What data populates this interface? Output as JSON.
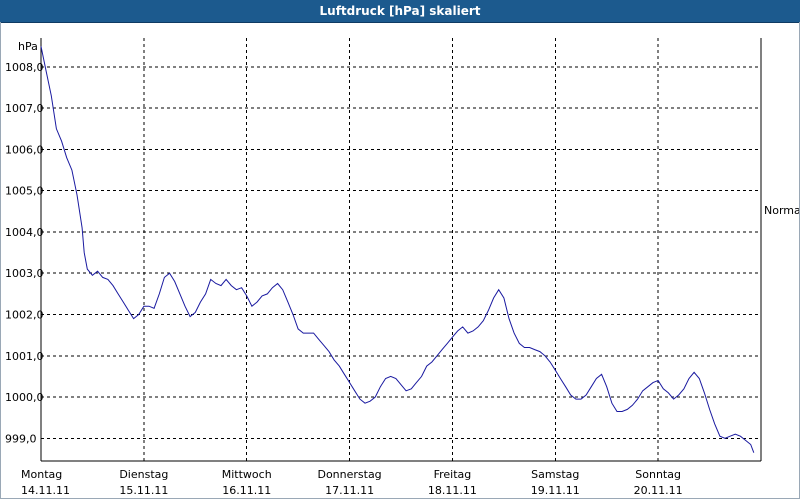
{
  "window": {
    "title": "Luftdruck [hPa] skaliert"
  },
  "chart_data": {
    "type": "line",
    "title": "Luftdruck [hPa] skaliert",
    "ylabel": "hPa",
    "ylim": [
      998.45,
      1008.7
    ],
    "yticks": [
      999.0,
      1000.0,
      1001.0,
      1002.0,
      1003.0,
      1004.0,
      1005.0,
      1006.0,
      1007.0,
      1008.0
    ],
    "ytick_labels": [
      "999,0",
      "1000,0",
      "1001,0",
      "1002,0",
      "1003,0",
      "1004,0",
      "1005,0",
      "1006,0",
      "1007,0",
      "1008,0"
    ],
    "xlim": [
      0,
      7
    ],
    "xticks": [
      {
        "x": 0,
        "day": "Montag",
        "date": "14.11.11"
      },
      {
        "x": 1,
        "day": "Dienstag",
        "date": "15.11.11"
      },
      {
        "x": 2,
        "day": "Mittwoch",
        "date": "16.11.11"
      },
      {
        "x": 3,
        "day": "Donnerstag",
        "date": "17.11.11"
      },
      {
        "x": 4,
        "day": "Freitag",
        "date": "18.11.11"
      },
      {
        "x": 5,
        "day": "Samstag",
        "date": "19.11.11"
      },
      {
        "x": 6,
        "day": "Sonntag",
        "date": "20.11.11"
      }
    ],
    "reference_label": "Normal",
    "grid": true,
    "grid_style": "dashed",
    "colors": {
      "line": "#1a1aa0",
      "grid": "#000000",
      "title_bar": "#1c5a8e"
    },
    "series": [
      {
        "values": [
          [
            0.0,
            1008.5
          ],
          [
            0.05,
            1007.9
          ],
          [
            0.1,
            1007.3
          ],
          [
            0.15,
            1006.5
          ],
          [
            0.2,
            1006.2
          ],
          [
            0.25,
            1005.8
          ],
          [
            0.3,
            1005.5
          ],
          [
            0.35,
            1004.9
          ],
          [
            0.4,
            1004.1
          ],
          [
            0.42,
            1003.5
          ],
          [
            0.45,
            1003.1
          ],
          [
            0.5,
            1002.95
          ],
          [
            0.55,
            1003.05
          ],
          [
            0.6,
            1002.9
          ],
          [
            0.65,
            1002.85
          ],
          [
            0.7,
            1002.7
          ],
          [
            0.75,
            1002.5
          ],
          [
            0.8,
            1002.3
          ],
          [
            0.85,
            1002.1
          ],
          [
            0.9,
            1001.9
          ],
          [
            0.95,
            1002.0
          ],
          [
            1.0,
            1002.2
          ],
          [
            1.05,
            1002.2
          ],
          [
            1.1,
            1002.15
          ],
          [
            1.15,
            1002.5
          ],
          [
            1.2,
            1002.9
          ],
          [
            1.25,
            1003.0
          ],
          [
            1.3,
            1002.8
          ],
          [
            1.35,
            1002.5
          ],
          [
            1.4,
            1002.2
          ],
          [
            1.45,
            1001.95
          ],
          [
            1.5,
            1002.05
          ],
          [
            1.55,
            1002.3
          ],
          [
            1.6,
            1002.5
          ],
          [
            1.65,
            1002.85
          ],
          [
            1.7,
            1002.75
          ],
          [
            1.75,
            1002.7
          ],
          [
            1.8,
            1002.85
          ],
          [
            1.85,
            1002.7
          ],
          [
            1.9,
            1002.6
          ],
          [
            1.95,
            1002.65
          ],
          [
            2.0,
            1002.45
          ],
          [
            2.05,
            1002.2
          ],
          [
            2.1,
            1002.3
          ],
          [
            2.15,
            1002.45
          ],
          [
            2.2,
            1002.5
          ],
          [
            2.25,
            1002.65
          ],
          [
            2.3,
            1002.75
          ],
          [
            2.35,
            1002.6
          ],
          [
            2.4,
            1002.3
          ],
          [
            2.45,
            1002.0
          ],
          [
            2.5,
            1001.65
          ],
          [
            2.55,
            1001.55
          ],
          [
            2.6,
            1001.55
          ],
          [
            2.65,
            1001.55
          ],
          [
            2.7,
            1001.4
          ],
          [
            2.75,
            1001.25
          ],
          [
            2.8,
            1001.1
          ],
          [
            2.85,
            1000.9
          ],
          [
            2.9,
            1000.75
          ],
          [
            2.95,
            1000.55
          ],
          [
            3.0,
            1000.35
          ],
          [
            3.05,
            1000.15
          ],
          [
            3.1,
            999.95
          ],
          [
            3.15,
            999.85
          ],
          [
            3.2,
            999.9
          ],
          [
            3.25,
            1000.0
          ],
          [
            3.3,
            1000.25
          ],
          [
            3.35,
            1000.45
          ],
          [
            3.4,
            1000.5
          ],
          [
            3.45,
            1000.45
          ],
          [
            3.5,
            1000.3
          ],
          [
            3.55,
            1000.15
          ],
          [
            3.6,
            1000.2
          ],
          [
            3.65,
            1000.35
          ],
          [
            3.7,
            1000.5
          ],
          [
            3.75,
            1000.75
          ],
          [
            3.8,
            1000.85
          ],
          [
            3.85,
            1001.0
          ],
          [
            3.9,
            1001.15
          ],
          [
            3.95,
            1001.3
          ],
          [
            4.0,
            1001.45
          ],
          [
            4.05,
            1001.6
          ],
          [
            4.1,
            1001.7
          ],
          [
            4.15,
            1001.55
          ],
          [
            4.2,
            1001.6
          ],
          [
            4.25,
            1001.7
          ],
          [
            4.3,
            1001.85
          ],
          [
            4.35,
            1002.1
          ],
          [
            4.4,
            1002.4
          ],
          [
            4.45,
            1002.6
          ],
          [
            4.5,
            1002.4
          ],
          [
            4.55,
            1001.9
          ],
          [
            4.6,
            1001.55
          ],
          [
            4.65,
            1001.3
          ],
          [
            4.7,
            1001.2
          ],
          [
            4.75,
            1001.2
          ],
          [
            4.8,
            1001.15
          ],
          [
            4.85,
            1001.1
          ],
          [
            4.9,
            1001.0
          ],
          [
            4.95,
            1000.85
          ],
          [
            5.0,
            1000.65
          ],
          [
            5.05,
            1000.45
          ],
          [
            5.1,
            1000.25
          ],
          [
            5.15,
            1000.05
          ],
          [
            5.2,
            999.95
          ],
          [
            5.25,
            999.95
          ],
          [
            5.3,
            1000.05
          ],
          [
            5.35,
            1000.25
          ],
          [
            5.4,
            1000.45
          ],
          [
            5.45,
            1000.55
          ],
          [
            5.5,
            1000.25
          ],
          [
            5.55,
            999.85
          ],
          [
            5.6,
            999.65
          ],
          [
            5.65,
            999.65
          ],
          [
            5.7,
            999.7
          ],
          [
            5.75,
            999.8
          ],
          [
            5.8,
            999.95
          ],
          [
            5.85,
            1000.15
          ],
          [
            5.9,
            1000.25
          ],
          [
            5.95,
            1000.35
          ],
          [
            6.0,
            1000.4
          ],
          [
            6.05,
            1000.2
          ],
          [
            6.1,
            1000.1
          ],
          [
            6.15,
            999.95
          ],
          [
            6.2,
            1000.05
          ],
          [
            6.25,
            1000.2
          ],
          [
            6.3,
            1000.45
          ],
          [
            6.35,
            1000.6
          ],
          [
            6.4,
            1000.45
          ],
          [
            6.45,
            1000.1
          ],
          [
            6.5,
            999.7
          ],
          [
            6.55,
            999.35
          ],
          [
            6.6,
            999.05
          ],
          [
            6.65,
            999.0
          ],
          [
            6.7,
            999.05
          ],
          [
            6.75,
            999.1
          ],
          [
            6.8,
            999.05
          ],
          [
            6.85,
            998.95
          ],
          [
            6.9,
            998.85
          ],
          [
            6.93,
            998.65
          ]
        ]
      }
    ]
  }
}
